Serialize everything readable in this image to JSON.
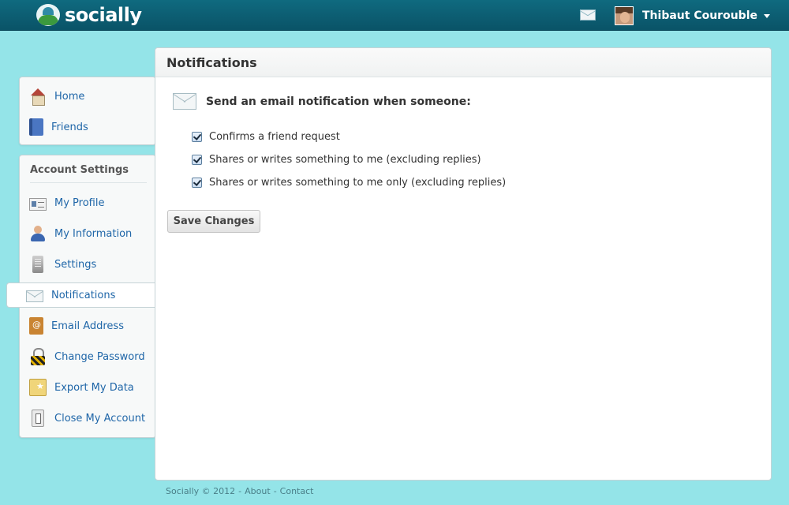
{
  "app": {
    "name": "socially"
  },
  "header": {
    "user_name": "Thibaut Courouble"
  },
  "sidebar": {
    "primary": [
      {
        "label": "Home",
        "icon": "house-icon"
      },
      {
        "label": "Friends",
        "icon": "address-book-icon"
      }
    ],
    "account_section_title": "Account Settings",
    "account": [
      {
        "label": "My Profile",
        "icon": "id-card-icon"
      },
      {
        "label": "My Information",
        "icon": "user-icon"
      },
      {
        "label": "Settings",
        "icon": "settings-icon"
      },
      {
        "label": "Notifications",
        "icon": "envelope-icon",
        "active": true
      },
      {
        "label": "Email Address",
        "icon": "at-book-icon"
      },
      {
        "label": "Change Password",
        "icon": "padlock-icon"
      },
      {
        "label": "Export My Data",
        "icon": "export-icon"
      },
      {
        "label": "Close My Account",
        "icon": "door-icon"
      }
    ]
  },
  "panel": {
    "title": "Notifications",
    "heading": "Send an email notification when someone:",
    "options": [
      {
        "label": "Confirms a friend request",
        "checked": true
      },
      {
        "label": "Shares or writes something to me (excluding replies)",
        "checked": true
      },
      {
        "label": "Shares or writes something to me only (excluding replies)",
        "checked": true
      }
    ],
    "save_label": "Save Changes"
  },
  "footer": {
    "copyright": "Socially © 2012",
    "sep1": "-",
    "about": "About",
    "sep2": "-",
    "contact": "Contact"
  }
}
